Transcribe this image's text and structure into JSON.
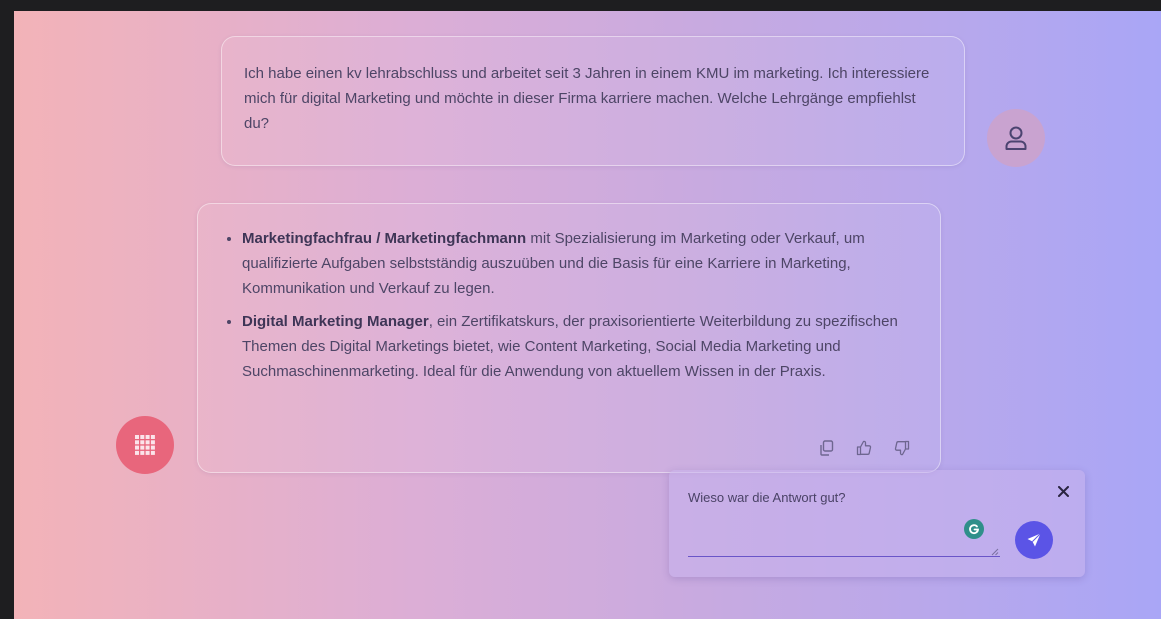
{
  "user_message": {
    "text": "Ich habe einen kv lehrabschluss und arbeitet seit 3 Jahren in einem KMU im marketing. Ich interessiere mich für digital Marketing und möchte in dieser Firma karriere machen. Welche Lehrgänge empfiehlst du?",
    "avatar_icon": "user-icon"
  },
  "bot_message": {
    "items": [
      {
        "title": "Marketingfachfrau / Marketingfachmann",
        "text": " mit Spezialisierung im Marketing oder Verkauf, um qualifizierte Aufgaben selbstständig auszuüben und die Basis für eine Karriere in Marketing, Kommunikation und Verkauf zu legen."
      },
      {
        "title": "Digital Marketing Manager",
        "text": ", ein Zertifikatskurs, der praxisorientierte Weiterbildung zu spezifischen Themen des Digital Marketings bietet, wie Content Marketing, Social Media Marketing und Suchmaschinenmarketing. Ideal für die Anwendung von aktuellem Wissen in der Praxis."
      }
    ],
    "actions": [
      "copy-icon",
      "thumbs-up-icon",
      "thumbs-down-icon"
    ],
    "bot_icon": "grid-icon"
  },
  "feedback": {
    "label": "Wieso war die Antwort gut?",
    "input_value": "",
    "close_icon": "close-icon",
    "send_icon": "send-icon"
  },
  "colors": {
    "bot_icon_bg": "#e8667c",
    "send_button_bg": "#5b54e6",
    "avatar_bg": "#c9a3d0"
  }
}
